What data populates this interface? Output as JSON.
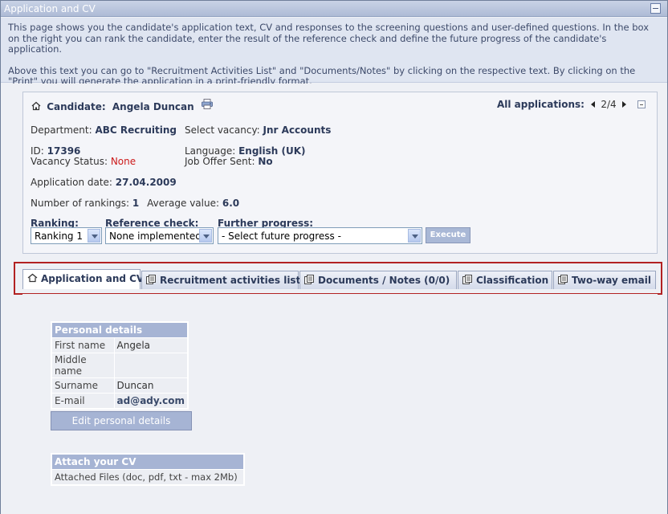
{
  "window": {
    "title": "Application and CV"
  },
  "intro": {
    "paragraph1": "This page shows you the candidate's application text, CV and responses to the screening questions and user-defined questions. In the box on the right you can rank the candidate, enter the result of the reference check and define the future progress of the candidate's application.",
    "paragraph2": "Above this text you can go to \"Recruitment Activities List\" and \"Documents/Notes\" by clicking on the respective text. By clicking on the \"Print\" you will generate the application in a print-friendly format."
  },
  "candidate": {
    "label": "Candidate:",
    "name": "Angela Duncan",
    "all_apps_label": "All applications:",
    "all_apps_position": "2/4",
    "department_label": "Department:",
    "department": "ABC Recruiting",
    "vacancy_label": "Select vacancy:",
    "vacancy": "Jnr Accounts",
    "id_label": "ID:",
    "id": "17396",
    "language_label": "Language:",
    "language": "English (UK)",
    "vacancy_status_label": "Vacancy Status:",
    "vacancy_status": "None",
    "offer_label": "Job Offer Sent:",
    "offer": "No",
    "appdate_label": "Application date:",
    "appdate": "27.04.2009",
    "rankings_label": "Number of rankings:",
    "rankings": "1",
    "avg_label": "Average value:",
    "avg": "6.0"
  },
  "controls": {
    "ranking_label": "Ranking:",
    "ranking_value": "Ranking 1",
    "refcheck_label": "Reference check:",
    "refcheck_value": "None implemented",
    "progress_label": "Further progress:",
    "progress_value": "- Select future progress -",
    "execute_label": "Execute"
  },
  "tabs": [
    {
      "label": "Application and CV",
      "icon": "home-icon"
    },
    {
      "label": "Recruitment activities list",
      "icon": "document-icon"
    },
    {
      "label": "Documents / Notes (0/0)",
      "icon": "document-icon"
    },
    {
      "label": "Classification",
      "icon": "document-icon"
    },
    {
      "label": "Two-way email",
      "icon": "document-icon"
    }
  ],
  "personal": {
    "header": "Personal details",
    "rows": [
      {
        "label": "First name",
        "value": "Angela"
      },
      {
        "label": "Middle name",
        "value": ""
      },
      {
        "label": "Surname",
        "value": "Duncan"
      },
      {
        "label": "E-mail",
        "value": "ad@ady.com"
      }
    ],
    "edit_label": "Edit personal details"
  },
  "cv": {
    "header": "Attach your CV",
    "row": "Attached Files (doc, pdf, txt - max 2Mb)"
  },
  "colors": {
    "tab_highlight": "#b22222",
    "header_blue": "#a6b4d4",
    "status_red": "#cc1a1a"
  }
}
